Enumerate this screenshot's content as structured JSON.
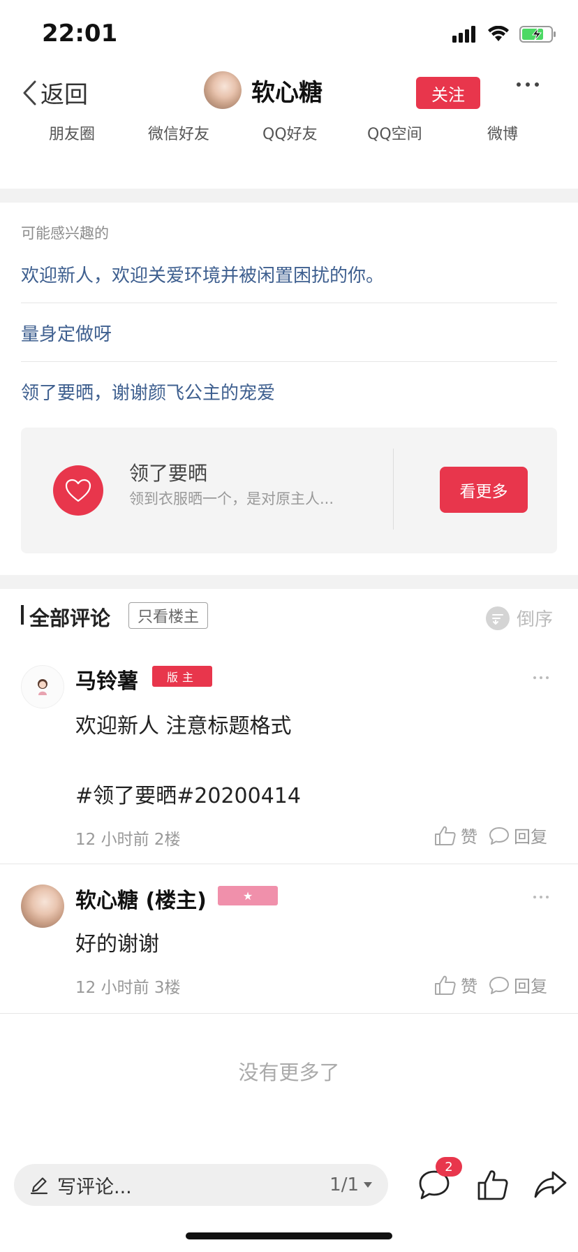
{
  "status_bar": {
    "time": "22:01"
  },
  "header": {
    "back_label": "返回",
    "author_name": "软心糖",
    "follow_label": "关注"
  },
  "share": {
    "items": [
      "朋友圈",
      "微信好友",
      "QQ好友",
      "QQ空间",
      "微博"
    ]
  },
  "interest": {
    "title": "可能感兴趣的",
    "links": [
      "欢迎新人，欢迎关爱环境并被闲置困扰的你。",
      "量身定做呀",
      "领了要晒，谢谢颜飞公主的宠爱"
    ],
    "topic": {
      "name": "领了要晒",
      "desc": "领到衣服晒一个，是对原主人...",
      "button": "看更多"
    }
  },
  "comments": {
    "title": "全部评论",
    "only_host": "只看楼主",
    "order": "倒序",
    "items": [
      {
        "name": "马铃薯",
        "badge": "版主",
        "text_line1": "欢迎新人 注意标题格式",
        "text_line2": "#领了要晒#20200414",
        "meta": "12 小时前  2楼",
        "like": "赞",
        "reply": "回复"
      },
      {
        "name": "软心糖 (楼主)",
        "badge": "★",
        "text_line1": "好的谢谢",
        "meta": "12 小时前  3楼",
        "like": "赞",
        "reply": "回复"
      }
    ],
    "no_more": "没有更多了"
  },
  "bottom_bar": {
    "placeholder": "写评论...",
    "page": "1/1",
    "comment_count": "2"
  },
  "colors": {
    "accent": "#e8364c",
    "link": "#3e5f8f",
    "battery": "#4cd964"
  }
}
